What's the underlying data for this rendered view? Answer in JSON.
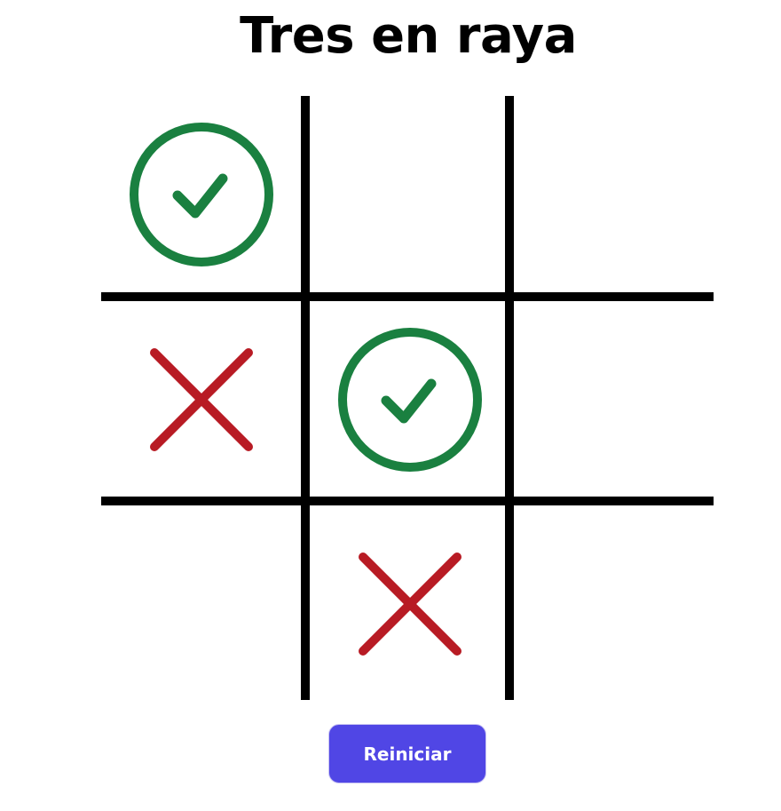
{
  "title": "Tres en raya",
  "board": [
    [
      "check",
      "",
      ""
    ],
    [
      "x",
      "check",
      ""
    ],
    [
      "",
      "x",
      ""
    ]
  ],
  "symbols": {
    "check": {
      "icon": "check-circle-icon",
      "color": "#1a8040"
    },
    "x": {
      "icon": "x-icon",
      "color": "#b81b24"
    }
  },
  "reset_button": {
    "label": "Reiniciar",
    "color": "#5046e5"
  }
}
